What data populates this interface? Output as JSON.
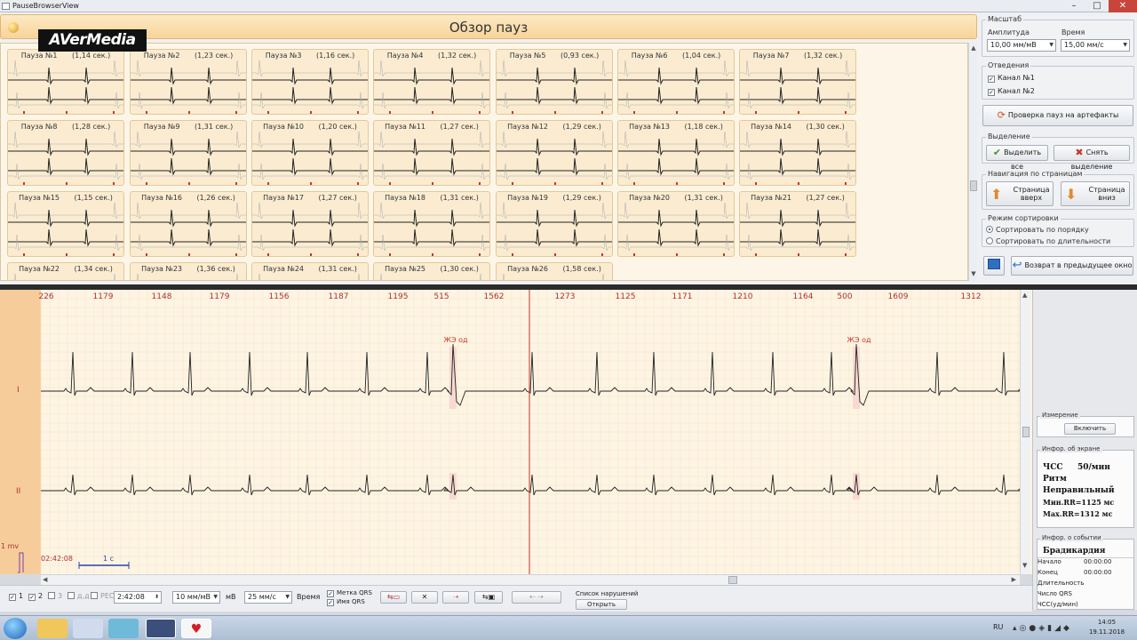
{
  "window": {
    "title": "PauseBrowserView"
  },
  "header": {
    "title": "Обзор пауз"
  },
  "logo": {
    "text": "AVerMedia"
  },
  "pauses": [
    {
      "label": "Пауза №1",
      "duration": "(1,14 сек.)"
    },
    {
      "label": "Пауза №2",
      "duration": "(1,23 сек.)"
    },
    {
      "label": "Пауза №3",
      "duration": "(1,16 сек.)"
    },
    {
      "label": "Пауза №4",
      "duration": "(1,32 сек.)"
    },
    {
      "label": "Пауза №5",
      "duration": "(0,93 сек.)"
    },
    {
      "label": "Пауза №6",
      "duration": "(1,04 сек.)"
    },
    {
      "label": "Пауза №7",
      "duration": "(1,32 сек.)"
    },
    {
      "label": "Пауза №8",
      "duration": "(1,28 сек.)"
    },
    {
      "label": "Пауза №9",
      "duration": "(1,31 сек.)"
    },
    {
      "label": "Пауза №10",
      "duration": "(1,20 сек.)"
    },
    {
      "label": "Пауза №11",
      "duration": "(1,27 сек.)"
    },
    {
      "label": "Пауза №12",
      "duration": "(1,29 сек.)"
    },
    {
      "label": "Пауза №13",
      "duration": "(1,18 сек.)"
    },
    {
      "label": "Пауза №14",
      "duration": "(1,30 сек.)"
    },
    {
      "label": "Пауза №15",
      "duration": "(1,15 сек.)"
    },
    {
      "label": "Пауза №16",
      "duration": "(1,26 сек.)"
    },
    {
      "label": "Пауза №17",
      "duration": "(1,27 сек.)"
    },
    {
      "label": "Пауза №18",
      "duration": "(1,31 сек.)"
    },
    {
      "label": "Пауза №19",
      "duration": "(1,29 сек.)"
    },
    {
      "label": "Пауза №20",
      "duration": "(1,31 сек.)"
    },
    {
      "label": "Пауза №21",
      "duration": "(1,27 сек.)"
    },
    {
      "label": "Пауза №22",
      "duration": "(1,34 сек.)"
    },
    {
      "label": "Пауза №23",
      "duration": "(1,36 сек.)"
    },
    {
      "label": "Пауза №24",
      "duration": "(1,31 сек.)"
    },
    {
      "label": "Пауза №25",
      "duration": "(1,30 сек.)"
    },
    {
      "label": "Пауза №26",
      "duration": "(1,58 сек.)"
    }
  ],
  "scale_panel": {
    "title": "Масштаб",
    "amplitude_label": "Амплитуда",
    "amplitude_value": "10,00 мм/мВ",
    "time_label": "Время",
    "time_value": "15,00 мм/с"
  },
  "leads_panel": {
    "title": "Отведения",
    "channel1": "Канал №1",
    "channel2": "Канал №2"
  },
  "artifact_button": "Проверка пауз на артефакты",
  "selection_panel": {
    "title": "Выделение",
    "select_all": "Выделить все",
    "deselect": "Снять выделение"
  },
  "nav_panel": {
    "title": "Навигация по страницам",
    "page_up_1": "Страница",
    "page_up_2": "вверх",
    "page_down_1": "Страница",
    "page_down_2": "вниз"
  },
  "sort_panel": {
    "title": "Режим сортировки",
    "by_order": "Сортировать по порядку",
    "by_duration": "Сортировать по длительности"
  },
  "back_button": "Возврат в предыдущее окно",
  "ecg": {
    "rr_values": [
      "226",
      "1179",
      "1148",
      "1179",
      "1156",
      "1187",
      "1195",
      "515",
      "1562",
      "1273",
      "1125",
      "1171",
      "1210",
      "1164",
      "500",
      "1609",
      "1312"
    ],
    "annotation": "ЖЭ од",
    "lead_1": "I",
    "lead_2": "II",
    "mv_label": "1 mv",
    "time_stamp": "02:42:08",
    "scale_label": "1 с"
  },
  "info": {
    "measure_title": "Измерение",
    "measure_button": "Включить",
    "screen_title": "Инфор. об экране",
    "hr_label": "ЧСС",
    "hr_value": "50/мин",
    "rhythm_label": "Ритм",
    "rhythm_value": "Неправильный",
    "min_rr": "Мин.RR=1125 мс",
    "max_rr": "Max.RR=1312 мс",
    "event_title": "Инфор. о событии",
    "event_name": "Брадикардия",
    "start_label": "Начало",
    "start_value": "00:00:00",
    "end_label": "Конец",
    "end_value": "00:00:00",
    "duration_label": "Длительность",
    "qrs_label": "Число QRS",
    "hr_unit_label": "ЧСС(уд/мин)"
  },
  "toolbar": {
    "ch1": "1",
    "ch2": "2",
    "ch3": "3",
    "ch_dd": "д.д",
    "ch_rec": "РЕС",
    "time_value": "2:42:08",
    "amp_value": "10 мм/мВ",
    "mv_unit": "мВ",
    "speed_value": "25 мм/с",
    "time_label": "Время",
    "qrs_mark": "Метка QRS",
    "qrs_name": "Имя QRS",
    "violations_title": "Список нарушений",
    "open_button": "Открыть"
  },
  "taskbar": {
    "lang": "RU",
    "time": "14:05",
    "date": "19.11.2018"
  },
  "colors": {
    "header": "#f7d49a",
    "thumb_bg": "#fbecd1",
    "ecg_bg": "#fdf4e3",
    "accent_red": "#c0392b",
    "rr_text": "#b03030"
  }
}
